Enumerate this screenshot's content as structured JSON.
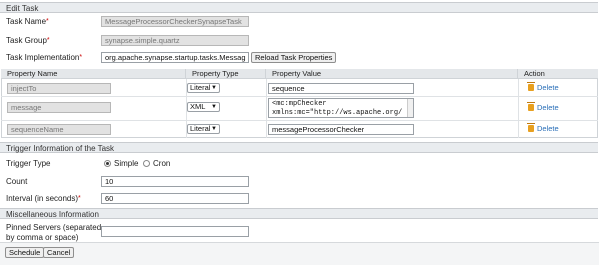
{
  "edit_task": {
    "header": "Edit Task",
    "task_name_label": "Task Name",
    "task_name_value": "MessageProcessorCheckerSynapseTask",
    "task_group_label": "Task Group",
    "task_group_value": "synapse.simple.quartz",
    "task_impl_label": "Task Implementation",
    "task_impl_value": "org.apache.synapse.startup.tasks.Messag",
    "reload_button": "Reload Task Properties",
    "required_mark": "*"
  },
  "properties_table": {
    "columns": [
      "Property Name",
      "Property Type",
      "Property Value",
      "Action"
    ],
    "rows": [
      {
        "name": "injectTo",
        "type": "Literal",
        "value": "sequence",
        "action": "Delete"
      },
      {
        "name": "message",
        "type": "XML",
        "value": "<mc:mpChecker\nxmlns:mc=\"http://ws.apache.org/",
        "action": "Delete"
      },
      {
        "name": "sequenceName",
        "type": "Literal",
        "value": "messageProcessorChecker",
        "action": "Delete"
      }
    ]
  },
  "trigger": {
    "header": "Trigger Information of the Task",
    "type_label": "Trigger Type",
    "options": [
      "Simple",
      "Cron"
    ],
    "selected": "Simple",
    "count_label": "Count",
    "count_value": "10",
    "interval_label": "Interval (in seconds)",
    "interval_value": "60"
  },
  "misc": {
    "header": "Miscellaneous Information",
    "pinned_label_line1": "Pinned Servers (separated",
    "pinned_label_line2": "by comma or space)",
    "pinned_value": ""
  },
  "footer": {
    "schedule_button": "Schedule",
    "cancel_button": "Cancel"
  }
}
